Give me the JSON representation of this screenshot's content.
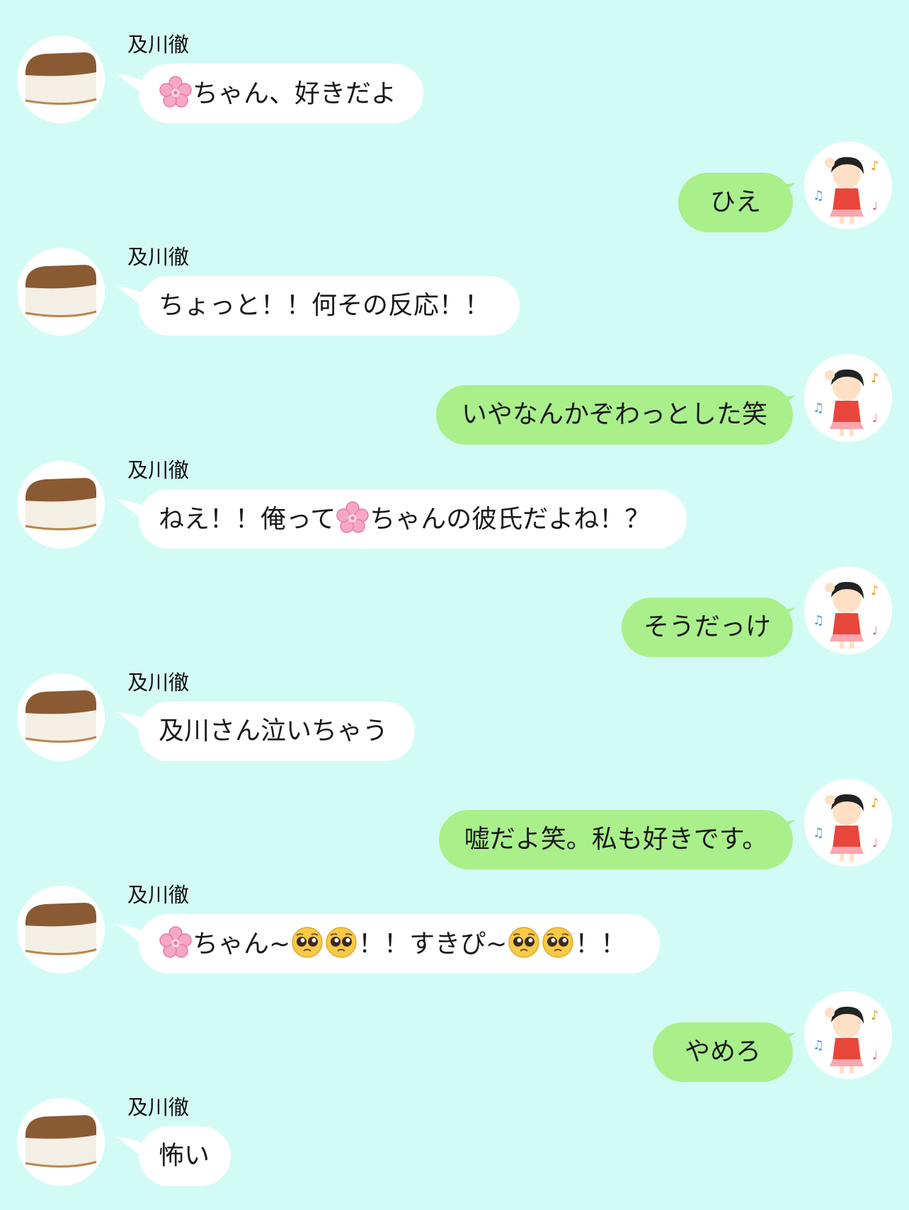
{
  "colors": {
    "background": "#d3fbf5",
    "incoming_bubble": "#ffffff",
    "outgoing_bubble": "#a9f08b",
    "text": "#1a1a1a"
  },
  "contact": {
    "name": "及川徹",
    "avatar_icon": "bread-loaf-icon"
  },
  "self": {
    "avatar_icon": "dancing-girl-icon"
  },
  "messages": [
    {
      "from": "contact",
      "sender": "及川徹",
      "parts": [
        "",
        "ちゃん、好きだよ"
      ],
      "icons": [
        "cherry-blossom-icon"
      ]
    },
    {
      "from": "self",
      "text": "ひえ"
    },
    {
      "from": "contact",
      "sender": "及川徹",
      "text": "ちょっと！！何その反応！！"
    },
    {
      "from": "self",
      "text": "いやなんかぞわっとした笑"
    },
    {
      "from": "contact",
      "sender": "及川徹",
      "parts": [
        "ねえ！！俺って",
        "ちゃんの彼氏だよね！？"
      ],
      "icons": [
        "cherry-blossom-icon"
      ]
    },
    {
      "from": "self",
      "text": "そうだっけ"
    },
    {
      "from": "contact",
      "sender": "及川徹",
      "text": "及川さん泣いちゃう"
    },
    {
      "from": "self",
      "text": "嘘だよ笑。私も好きです。"
    },
    {
      "from": "contact",
      "sender": "及川徹",
      "parts": [
        "",
        "ちゃん~",
        "",
        "！！すきぴ~",
        "",
        "！！"
      ],
      "icons": [
        "cherry-blossom-icon",
        "pleading-face-icon",
        "pleading-face-icon"
      ]
    },
    {
      "from": "self",
      "text": "やめろ"
    },
    {
      "from": "contact",
      "sender": "及川徹",
      "text": "怖い"
    }
  ]
}
